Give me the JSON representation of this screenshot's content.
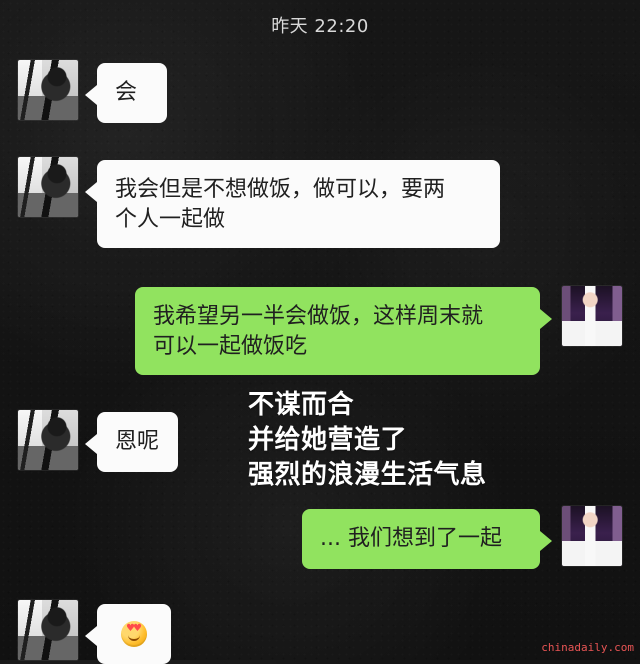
{
  "header": {
    "timestamp": "昨天 22:20"
  },
  "messages": [
    {
      "side": "left",
      "text": "会"
    },
    {
      "side": "left",
      "text": "我会但是不想做饭，做可以，要两\n个人一起做"
    },
    {
      "side": "right",
      "text": "我希望另一半会做饭，这样周末就\n可以一起做饭吃"
    },
    {
      "side": "left",
      "text": "恩呢"
    },
    {
      "side": "right",
      "text": "... 我们想到了一起"
    },
    {
      "side": "left",
      "emoji": "heart-eyes-emoji"
    }
  ],
  "overlay": {
    "lines": [
      "不谋而合",
      "并给她营造了",
      "强烈的浪漫生活气息"
    ]
  },
  "watermark": {
    "text": "chinadaily.com"
  }
}
